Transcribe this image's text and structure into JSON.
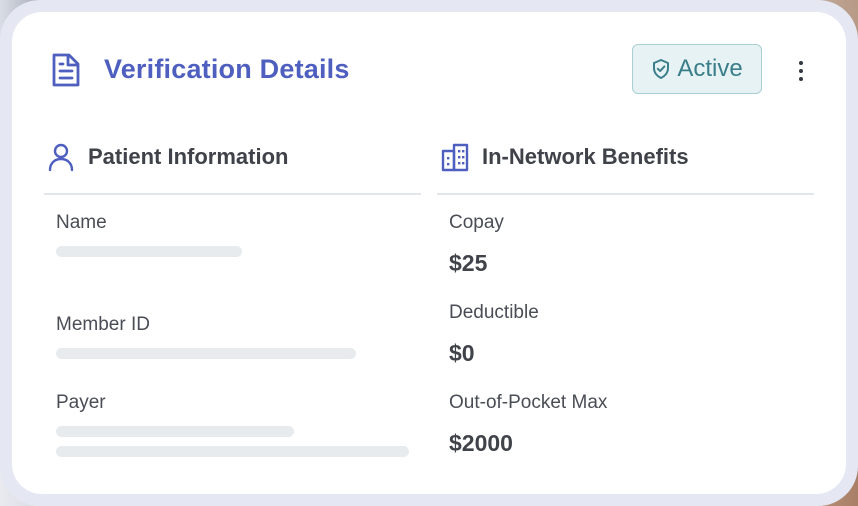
{
  "card": {
    "title": "Verification Details",
    "status": "Active",
    "status_colors": {
      "text": "#3a7e8a",
      "background": "#e6f2f3",
      "border": "#a9cfd3"
    },
    "accent": "#4f5fbf"
  },
  "patient": {
    "heading": "Patient Information",
    "icon": "user-icon",
    "fields": [
      {
        "label": "Name",
        "loading": true
      },
      {
        "label": "Member ID",
        "loading": true
      },
      {
        "label": "Payer",
        "loading": true
      }
    ]
  },
  "benefits": {
    "heading": "In-Network Benefits",
    "icon": "building-icon",
    "fields": [
      {
        "label": "Copay",
        "value": "$25"
      },
      {
        "label": "Deductible",
        "value": "$0"
      },
      {
        "label": "Out-of-Pocket Max",
        "value": "$2000"
      }
    ]
  }
}
